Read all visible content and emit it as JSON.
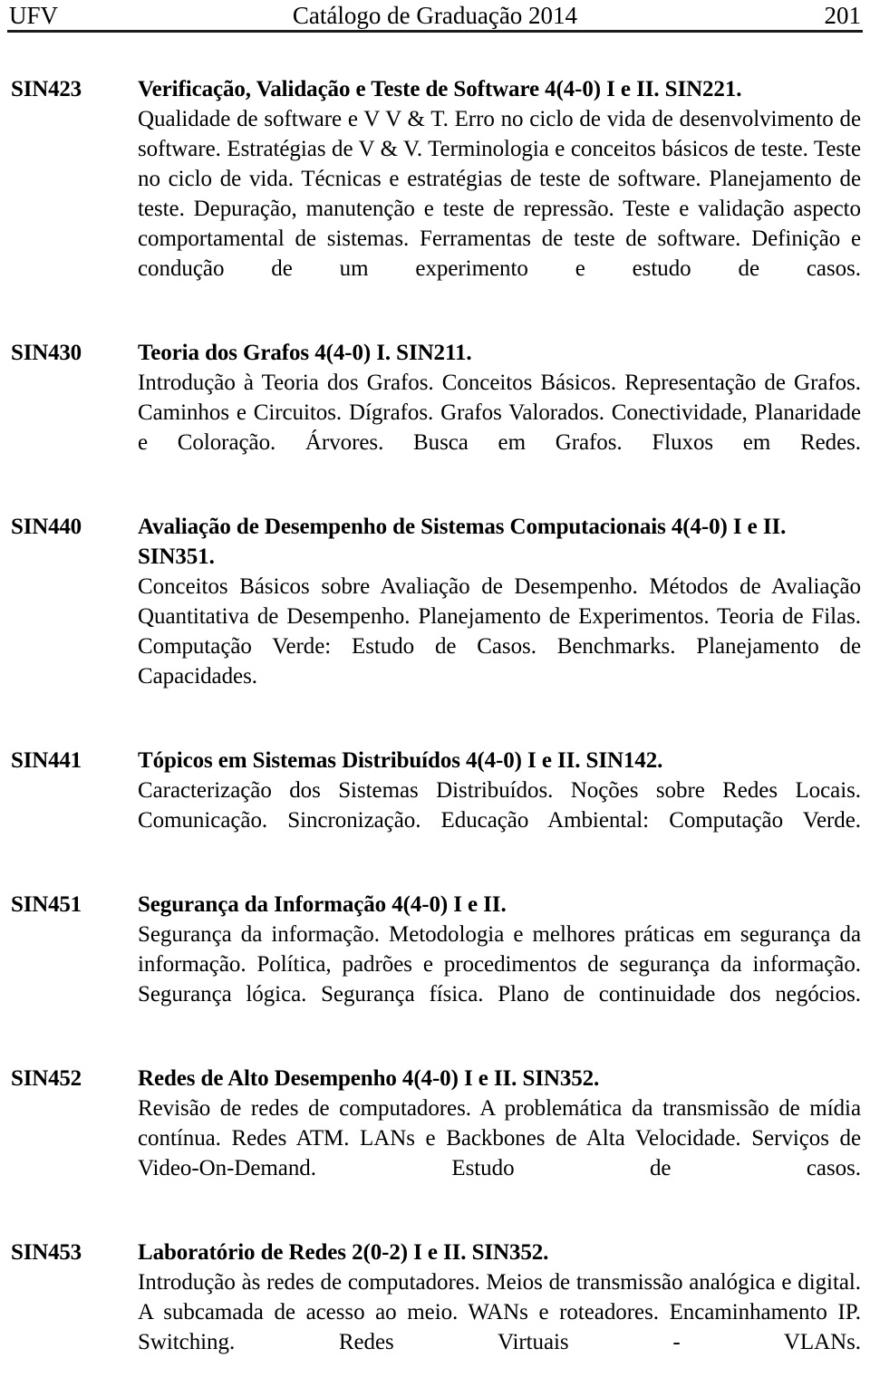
{
  "header": {
    "left": "UFV",
    "center": "Catálogo de Graduação 2014",
    "page_number": "201"
  },
  "courses": [
    {
      "code": "SIN423",
      "title": "Verificação, Validação e Teste de Software 4(4-0) I e II. SIN221.",
      "description": "Qualidade de software e V V & T. Erro no ciclo de vida de desenvolvimento de software. Estratégias de V & V. Terminologia e conceitos básicos de teste. Teste no ciclo de vida. Técnicas e estratégias de teste de software. Planejamento de teste. Depuração, manutenção e teste de repressão. Teste e validação aspecto comportamental de sistemas. Ferramentas de teste de software. Definição e condução de um experimento e estudo de casos."
    },
    {
      "code": "SIN430",
      "title": "Teoria dos Grafos 4(4-0) I. SIN211.",
      "description": "Introdução à Teoria dos Grafos. Conceitos Básicos. Representação de Grafos. Caminhos e Circuitos. Dígrafos. Grafos Valorados. Conectividade, Planaridade e Coloração. Árvores. Busca em Grafos. Fluxos em Redes."
    },
    {
      "code": "SIN440",
      "title": "Avaliação de Desempenho de Sistemas Computacionais 4(4-0) I e II. SIN351.",
      "description": "Conceitos Básicos sobre Avaliação de Desempenho. Métodos de Avaliação Quantitativa de Desempenho. Planejamento de Experimentos. Teoria de Filas. Computação Verde: Estudo de Casos. Benchmarks. Planejamento de Capacidades."
    },
    {
      "code": "SIN441",
      "title": "Tópicos em Sistemas Distribuídos 4(4-0) I e II. SIN142.",
      "description": "Caracterização dos Sistemas Distribuídos. Noções sobre Redes Locais. Comunicação. Sincronização. Educação Ambiental: Computação Verde."
    },
    {
      "code": "SIN451",
      "title": "Segurança da Informação 4(4-0) I e II.",
      "description": "Segurança da informação. Metodologia e melhores práticas em segurança da informação. Política, padrões e procedimentos de segurança da informação. Segurança lógica. Segurança física. Plano de continuidade dos negócios."
    },
    {
      "code": "SIN452",
      "title": "Redes de Alto Desempenho 4(4-0) I e II. SIN352.",
      "description": "Revisão de redes de computadores. A problemática da transmissão de mídia contínua. Redes ATM. LANs e Backbones de Alta Velocidade. Serviços de Video-On-Demand. Estudo de casos."
    },
    {
      "code": "SIN453",
      "title": "Laboratório de Redes 2(0-2) I e II. SIN352.",
      "description": "Introdução às redes de computadores. Meios de transmissão analógica e digital. A subcamada de acesso ao meio. WANs e roteadores. Encaminhamento IP. Switching. Redes Virtuais - VLANs."
    }
  ]
}
